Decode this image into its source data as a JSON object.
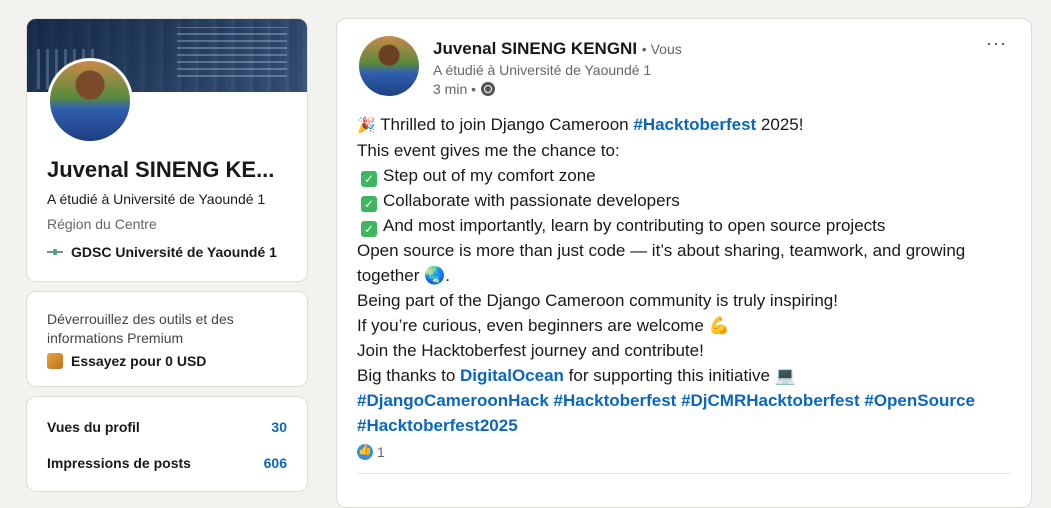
{
  "profile": {
    "name": "Juvenal SINENG KE...",
    "headline": "A étudié à Université de Yaoundé 1",
    "location": "Région du Centre",
    "organization": "GDSC Université de Yaoundé 1"
  },
  "premium": {
    "text": "Déverrouillez des outils et des informations Premium",
    "cta": "Essayez pour 0 USD"
  },
  "stats": [
    {
      "label": "Vues du profil",
      "value": "30"
    },
    {
      "label": "Impressions de posts",
      "value": "606"
    }
  ],
  "post": {
    "author": "Juvenal SINENG KENGNI",
    "you_label": "• Vous",
    "headline": "A étudié à Université de Yaoundé 1",
    "time": "3 min •",
    "menu": "···",
    "lines": {
      "l1_pre": "Thrilled to join Django Cameroon ",
      "l1_tag": "#Hacktoberfest",
      "l1_post": " 2025!",
      "l2": "This event gives me the chance to:",
      "l3": "Step out of my comfort zone",
      "l4": "Collaborate with passionate developers",
      "l5": "And most importantly, learn by contributing to open source projects",
      "l6": "Open source is more than just code — it’s about sharing, teamwork, and growing",
      "l7": "together 🌏.",
      "l8": " Being part of the Django Cameroon community is truly inspiring!",
      "l9": "If you’re curious, even beginners are welcome 💪",
      "l10": " Join the Hacktoberfest journey and contribute!",
      "l11_pre": "Big thanks to ",
      "l11_tag": "DigitalOcean",
      "l11_post": " for supporting this initiative 💻",
      "tags1": [
        "#DjangoCameroonHack",
        "#Hacktoberfest",
        "#DjCMRHacktoberfest",
        "#OpenSource"
      ],
      "tags2": "#Hacktoberfest2025"
    },
    "reaction_count": "1"
  },
  "colors": {
    "accent": "#0a66c2",
    "background": "#f4f2ee"
  }
}
